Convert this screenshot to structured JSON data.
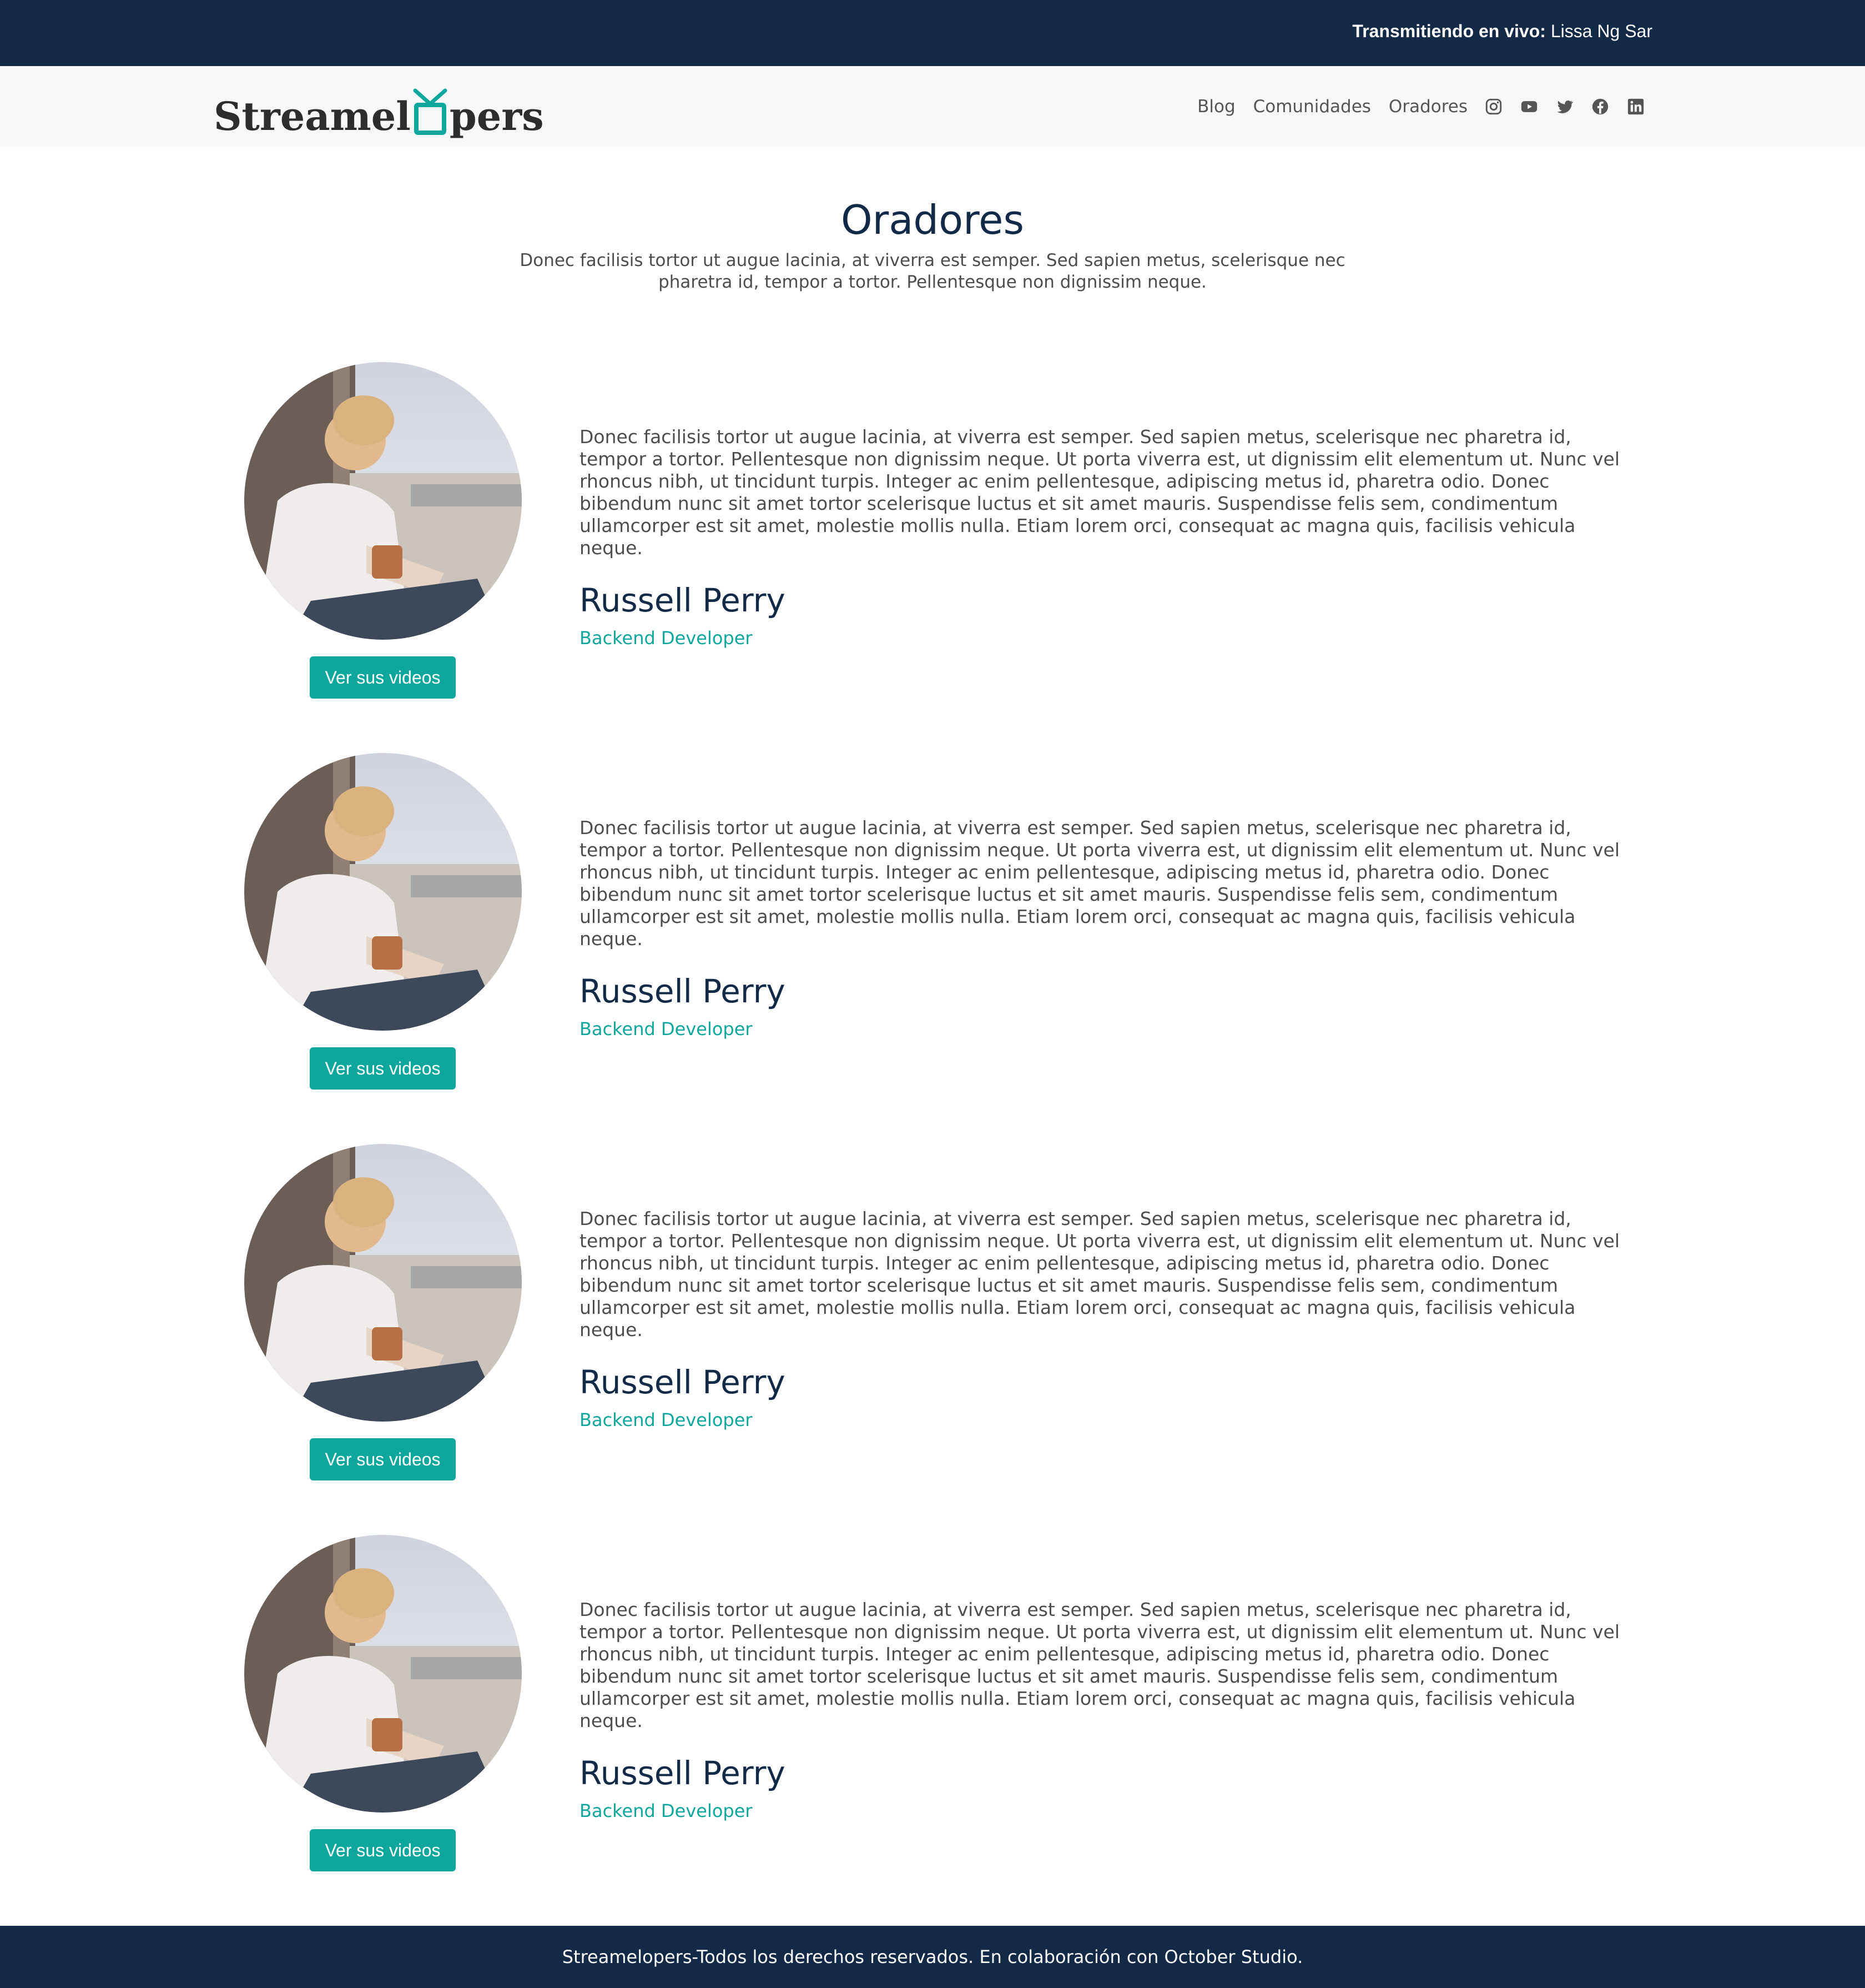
{
  "topbar": {
    "live_label": "Transmitiendo en vivo:",
    "live_name": "Lissa Ng Sar"
  },
  "header": {
    "logo_text_left": "Streamel",
    "logo_text_right": "pers",
    "nav": [
      "Blog",
      "Comunidades",
      "Oradores"
    ],
    "social_icons": [
      "instagram-icon",
      "youtube-icon",
      "twitter-icon",
      "facebook-icon",
      "linkedin-icon"
    ]
  },
  "intro": {
    "title": "Oradores",
    "text": "Donec facilisis tortor ut augue lacinia, at viverra est semper. Sed sapien metus, scelerisque nec pharetra id, tempor a tortor. Pellentesque non dignissim neque."
  },
  "speakers": [
    {
      "bio": "Donec facilisis tortor ut augue lacinia, at viverra est semper. Sed sapien metus, scelerisque nec pharetra id, tempor a tortor. Pellentesque non dignissim neque. Ut porta viverra est, ut dignissim elit elementum ut. Nunc vel rhoncus nibh, ut tincidunt turpis. Integer ac enim pellentesque, adipiscing metus id, pharetra odio. Donec bibendum nunc sit amet tortor scelerisque luctus et sit amet mauris. Suspendisse felis sem, condimentum ullamcorper est sit amet, molestie mollis nulla. Etiam lorem orci, consequat ac magna quis, facilisis vehicula neque.",
      "name": "Russell Perry",
      "role": "Backend Developer",
      "button": "Ver sus videos"
    },
    {
      "bio": "Donec facilisis tortor ut augue lacinia, at viverra est semper. Sed sapien metus, scelerisque nec pharetra id, tempor a tortor. Pellentesque non dignissim neque. Ut porta viverra est, ut dignissim elit elementum ut. Nunc vel rhoncus nibh, ut tincidunt turpis. Integer ac enim pellentesque, adipiscing metus id, pharetra odio. Donec bibendum nunc sit amet tortor scelerisque luctus et sit amet mauris. Suspendisse felis sem, condimentum ullamcorper est sit amet, molestie mollis nulla. Etiam lorem orci, consequat ac magna quis, facilisis vehicula neque.",
      "name": "Russell Perry",
      "role": "Backend Developer",
      "button": "Ver sus videos"
    },
    {
      "bio": "Donec facilisis tortor ut augue lacinia, at viverra est semper. Sed sapien metus, scelerisque nec pharetra id, tempor a tortor. Pellentesque non dignissim neque. Ut porta viverra est, ut dignissim elit elementum ut. Nunc vel rhoncus nibh, ut tincidunt turpis. Integer ac enim pellentesque, adipiscing metus id, pharetra odio. Donec bibendum nunc sit amet tortor scelerisque luctus et sit amet mauris. Suspendisse felis sem, condimentum ullamcorper est sit amet, molestie mollis nulla. Etiam lorem orci, consequat ac magna quis, facilisis vehicula neque.",
      "name": "Russell Perry",
      "role": "Backend Developer",
      "button": "Ver sus videos"
    },
    {
      "bio": "Donec facilisis tortor ut augue lacinia, at viverra est semper. Sed sapien metus, scelerisque nec pharetra id, tempor a tortor. Pellentesque non dignissim neque. Ut porta viverra est, ut dignissim elit elementum ut. Nunc vel rhoncus nibh, ut tincidunt turpis. Integer ac enim pellentesque, adipiscing metus id, pharetra odio. Donec bibendum nunc sit amet tortor scelerisque luctus et sit amet mauris. Suspendisse felis sem, condimentum ullamcorper est sit amet, molestie mollis nulla. Etiam lorem orci, consequat ac magna quis, facilisis vehicula neque.",
      "name": "Russell Perry",
      "role": "Backend Developer",
      "button": "Ver sus videos"
    }
  ],
  "footer": {
    "text": "Streamelopers-Todos los derechos reservados. En colaboración con October Studio."
  },
  "colors": {
    "navy": "#122947",
    "teal": "#0ea79d",
    "header_bg": "#f7f8fa"
  }
}
